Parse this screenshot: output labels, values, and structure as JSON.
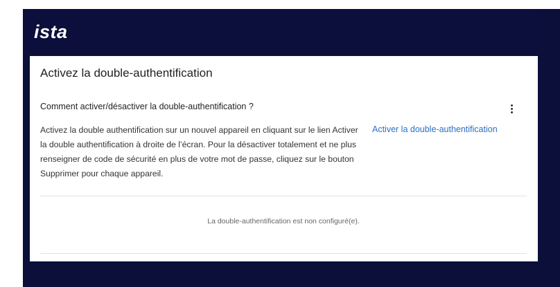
{
  "header": {
    "logo_text": "ista"
  },
  "card": {
    "title": "Activez la double-authentification",
    "section_title": "Comment activer/désactiver la double-authentification ?",
    "description": "Activez la double authentification sur un nouvel appareil en cliquant sur le lien Activer la double authentification à droite de l’écran. Pour la désactiver totalement et ne plus renseigner de code de sécurité en plus de votre mot de passe, cliquez sur le bouton Supprimer pour chaque appareil.",
    "activate_link": "Activer la double-authentification",
    "status": "La double-authentification est non configuré(e).",
    "menu_icon": "more-vertical-icon"
  },
  "colors": {
    "header_bg": "#0c0f3b",
    "link": "#2a6fc2"
  }
}
